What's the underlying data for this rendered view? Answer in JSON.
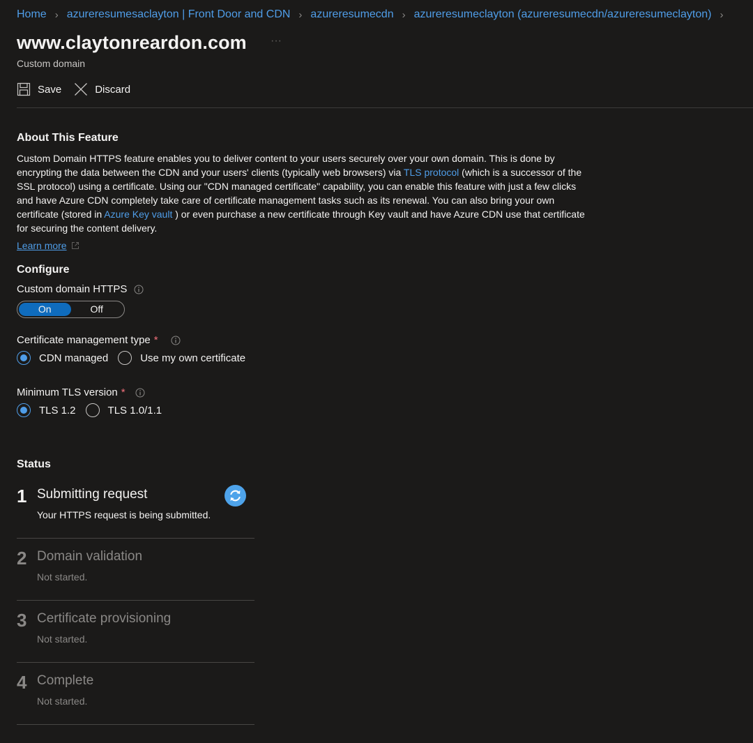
{
  "breadcrumb": {
    "items": [
      "Home",
      "azureresumesaclayton | Front Door and CDN",
      "azureresumecdn",
      "azureresumeclayton (azureresumecdn/azureresumeclayton)"
    ]
  },
  "header": {
    "title": "www.claytonreardon.com",
    "more": "···",
    "subtitle": "Custom domain"
  },
  "toolbar": {
    "save_label": "Save",
    "discard_label": "Discard"
  },
  "about": {
    "title": "About This Feature",
    "text_1": "Custom Domain HTTPS feature enables you to deliver content to your users securely over your own domain. This is done by encrypting the data between the CDN and your users' clients (typically web browsers) via ",
    "tls_link": "TLS protocol",
    "text_2": " (which is a successor of the SSL protocol) using a certificate. Using our \"CDN managed certificate\" capability, you can enable this feature with just a few clicks and have Azure CDN completely take care of certificate management tasks such as its renewal. You can also bring your own certificate (stored in ",
    "keyvault_link": "Azure Key vault",
    "text_3": " ) or even purchase a new certificate through Key vault and have Azure CDN use that certificate for securing the content delivery.",
    "learn_more": "Learn more"
  },
  "configure": {
    "title": "Configure",
    "https_label": "Custom domain HTTPS",
    "toggle_on": "On",
    "toggle_off": "Off",
    "https_value": "On",
    "cert_label": "Certificate management type",
    "cert_required": "*",
    "cert_options": [
      "CDN managed",
      "Use my own certificate"
    ],
    "cert_selected": "CDN managed",
    "tls_label": "Minimum TLS version",
    "tls_required": "*",
    "tls_options": [
      "TLS 1.2",
      "TLS 1.0/1.1"
    ],
    "tls_selected": "TLS 1.2"
  },
  "status": {
    "title": "Status",
    "steps": [
      {
        "num": "1",
        "title": "Submitting request",
        "desc": "Your HTTPS request is being submitted.",
        "state": "in-progress"
      },
      {
        "num": "2",
        "title": "Domain validation",
        "desc": "Not started.",
        "state": "not-started"
      },
      {
        "num": "3",
        "title": "Certificate provisioning",
        "desc": "Not started.",
        "state": "not-started"
      },
      {
        "num": "4",
        "title": "Complete",
        "desc": "Not started.",
        "state": "not-started"
      }
    ]
  },
  "colors": {
    "background": "#1b1a19",
    "link": "#4f9de8",
    "toggle_selected": "#0f6cbd",
    "required": "#f1707b",
    "spinner": "#4ea3ea"
  },
  "icons": [
    "chevron-right-icon",
    "save-icon",
    "close-icon",
    "external-link-icon",
    "info-icon",
    "refresh-icon"
  ]
}
